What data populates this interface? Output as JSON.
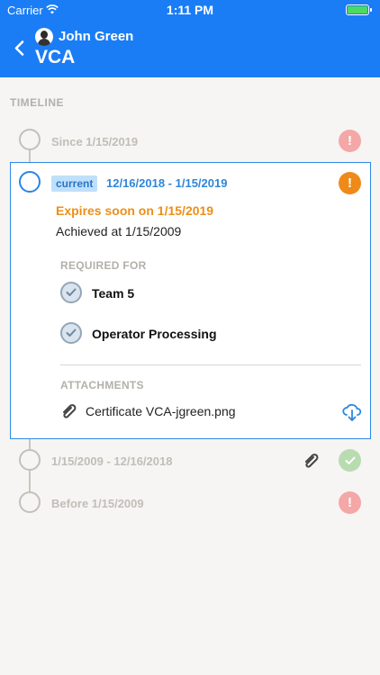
{
  "status_bar": {
    "carrier": "Carrier",
    "time": "1:11 PM"
  },
  "header": {
    "user_name": "John Green",
    "title": "VCA"
  },
  "timeline": {
    "label": "TIMELINE",
    "entries": [
      {
        "text": "Since 1/15/2019",
        "status": "warning"
      },
      {
        "badge": "current",
        "date_range": "12/16/2018 - 1/15/2019",
        "status": "warning",
        "expires_text": "Expires soon on 1/15/2019",
        "achieved_text": "Achieved at 1/15/2009",
        "required_label": "REQUIRED FOR",
        "required_for": [
          "Team 5",
          "Operator Processing"
        ],
        "attachments_label": "ATTACHMENTS",
        "attachments": [
          "Certificate VCA-jgreen.png"
        ]
      },
      {
        "text": "1/15/2009 - 12/16/2018",
        "status": "valid",
        "has_attachment": true
      },
      {
        "text": "Before 1/15/2009",
        "status": "warning"
      }
    ]
  },
  "colors": {
    "header": "#1a7df6",
    "accent": "#2e8ae8",
    "warning_orange": "#ef8a18",
    "warning_red": "#f4a7a7",
    "valid_green": "#b9dbb0"
  },
  "icons": [
    "back-chevron-icon",
    "avatar",
    "wifi-icon",
    "battery-icon",
    "exclamation-icon",
    "checkmark-icon",
    "paperclip-icon",
    "cloud-download-icon"
  ]
}
